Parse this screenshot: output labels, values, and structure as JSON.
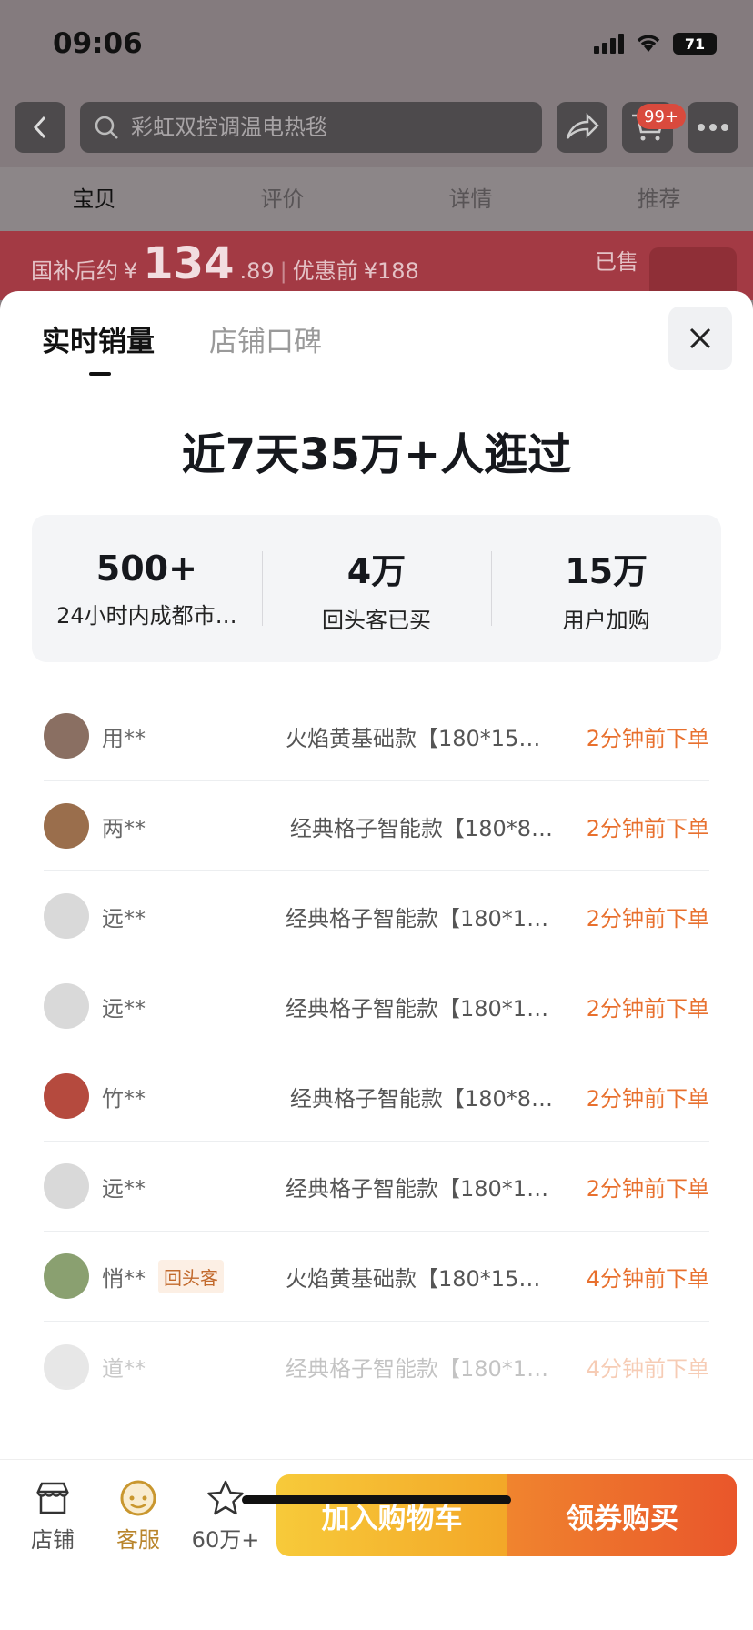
{
  "status_bar": {
    "time": "09:06",
    "battery": "71"
  },
  "nav": {
    "search_placeholder": "彩虹双控调温电热毯",
    "cart_badge": "99+"
  },
  "tabs": [
    "宝贝",
    "评价",
    "详情",
    "推荐"
  ],
  "price_bar": {
    "label_after": "国补后约",
    "currency": "¥",
    "price_int": "134",
    "price_dec": ".89",
    "label_before": "优惠前",
    "price_before": "¥188",
    "sold": "已售"
  },
  "sheet": {
    "tabs": [
      "实时销量",
      "店铺口碑"
    ],
    "headline": "近7天35万+人逛过",
    "stats": [
      {
        "value": "500+",
        "label": "24小时内成都市…"
      },
      {
        "value": "4万",
        "label": "回头客已买"
      },
      {
        "value": "15万",
        "label": "用户加购"
      }
    ],
    "orders": [
      {
        "user": "用**",
        "tag": "",
        "product": "火焰黄基础款【180*150…",
        "time": "2分钟前下单",
        "avatar_color": "#8a6f62"
      },
      {
        "user": "两**",
        "tag": "",
        "product": "经典格子智能款【180*8…",
        "time": "2分钟前下单",
        "avatar_color": "#9a6e4c"
      },
      {
        "user": "远**",
        "tag": "",
        "product": "经典格子智能款【180*15…",
        "time": "2分钟前下单",
        "avatar_color": "#d9d9d9"
      },
      {
        "user": "远**",
        "tag": "",
        "product": "经典格子智能款【180*15…",
        "time": "2分钟前下单",
        "avatar_color": "#d9d9d9"
      },
      {
        "user": "竹**",
        "tag": "",
        "product": "经典格子智能款【180*8…",
        "time": "2分钟前下单",
        "avatar_color": "#b54a3e"
      },
      {
        "user": "远**",
        "tag": "",
        "product": "经典格子智能款【180*15…",
        "time": "2分钟前下单",
        "avatar_color": "#d9d9d9"
      },
      {
        "user": "悄**",
        "tag": "回头客",
        "product": "火焰黄基础款【180*150…",
        "time": "4分钟前下单",
        "avatar_color": "#8aa070"
      },
      {
        "user": "道**",
        "tag": "",
        "product": "经典格子智能款【180*15…",
        "time": "4分钟前下单",
        "avatar_color": "#bdbdbd"
      }
    ]
  },
  "actions": {
    "store": "店铺",
    "service": "客服",
    "favorites": "60万+",
    "add_to_cart": "加入购物车",
    "buy": "领券购买"
  },
  "colors": {
    "accent_orange": "#e8702e",
    "cart_yellow": "#f7ca3a",
    "buy_orange": "#e9562b"
  }
}
